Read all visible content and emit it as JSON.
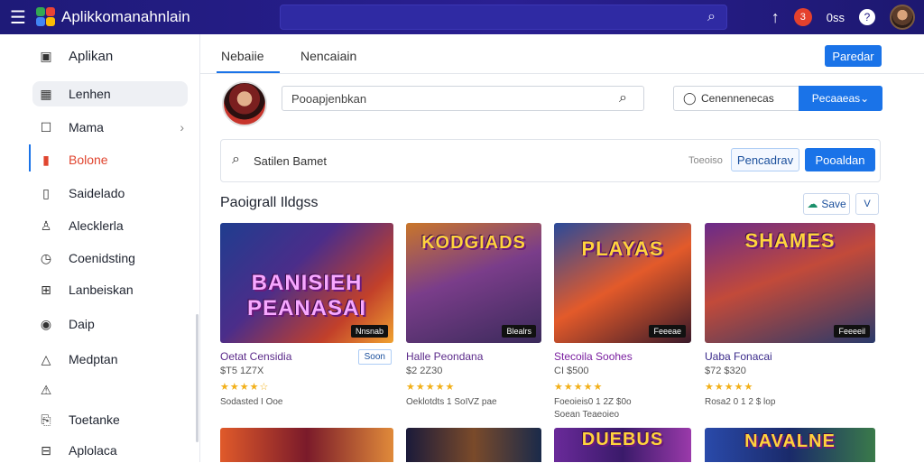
{
  "topbar": {
    "brand": "Aplikkomanahnlain",
    "notif_count": "3",
    "account_label": "0ss"
  },
  "sidebar": {
    "items": [
      {
        "label": "Aplikan",
        "icon": "info-box-icon"
      },
      {
        "label": "Lenhen",
        "icon": "grid-icon"
      },
      {
        "label": "Mama",
        "icon": "square-icon"
      },
      {
        "label": "Bolone",
        "icon": "bar-icon"
      },
      {
        "label": "Saidelado",
        "icon": "tablet-icon"
      },
      {
        "label": "Alecklerla",
        "icon": "person-icon"
      },
      {
        "label": "Coenidsting",
        "icon": "clock-icon"
      },
      {
        "label": "Lanbeiskan",
        "icon": "grid-box-icon"
      },
      {
        "label": "Daip",
        "icon": "target-icon"
      },
      {
        "label": "Medptan",
        "icon": "triangle-icon"
      },
      {
        "label": "",
        "icon": "alert-icon"
      },
      {
        "label": "Toetanke",
        "icon": "bookmark-icon"
      },
      {
        "label": "Aplolaca",
        "icon": "minus-box-icon"
      }
    ]
  },
  "tabs": [
    {
      "label": "Nebaiie"
    },
    {
      "label": "Nencaiain"
    }
  ],
  "header_button": "Paredar",
  "search": {
    "placeholder": "Pooapjenbkan"
  },
  "combo": {
    "label": "Cenennenecas",
    "selected": "Pecaaeas"
  },
  "filter": {
    "label": "Satilen Bamet",
    "muted": "Toeoiso",
    "secondary_button": "Pencadrav",
    "primary_button": "Pooaldan"
  },
  "section": {
    "title": "Paoigrall Ildgss",
    "save_label": "Save",
    "chevron": "V"
  },
  "cards": [
    {
      "thumb_title": "BANISIEH PEANASAI",
      "tag": "Nnsnab",
      "name": "Oetat Censidia",
      "price": "$T5 1Z7X",
      "stars": "★★★★☆",
      "meta": "Sodasted I Ooe",
      "meta2": "",
      "badge": "Soon",
      "name_color": "#5b2a8a"
    },
    {
      "thumb_title": "KODGIADS",
      "tag": "Blealrs",
      "name": "Halle Peondana",
      "price": "$2 2Z30",
      "stars": "★★★★★",
      "meta": "Oeklotdts 1 SoIVZ pae",
      "meta2": "",
      "badge": "",
      "name_color": "#5b2a8a"
    },
    {
      "thumb_title": "PLAYAS",
      "tag": "Feeeae",
      "name": "Stecoila Soohes",
      "price": "CI $500",
      "stars": "★★★★★",
      "meta": "Foeoieis0 1 2Z $0o",
      "meta2": "Soean Teaeoieo",
      "badge": "",
      "name_color": "#7a1fa0"
    },
    {
      "thumb_title": "SHAMES",
      "tag": "Feeeeil",
      "name": "Uaba Fonacai",
      "price": "$72 $320",
      "stars": "★★★★★",
      "meta": "Rosa2 0 1 2 $ lop",
      "meta2": "",
      "badge": "",
      "name_color": "#3a2a8a"
    }
  ],
  "cards_row2": [
    {
      "thumb_title": ""
    },
    {
      "thumb_title": ""
    },
    {
      "thumb_title": "DUEBUS"
    },
    {
      "thumb_title": "NAVALNE"
    }
  ],
  "colors": {
    "accent": "#1a73e8",
    "topbar": "#231c86",
    "active_item": "#e0452f"
  }
}
